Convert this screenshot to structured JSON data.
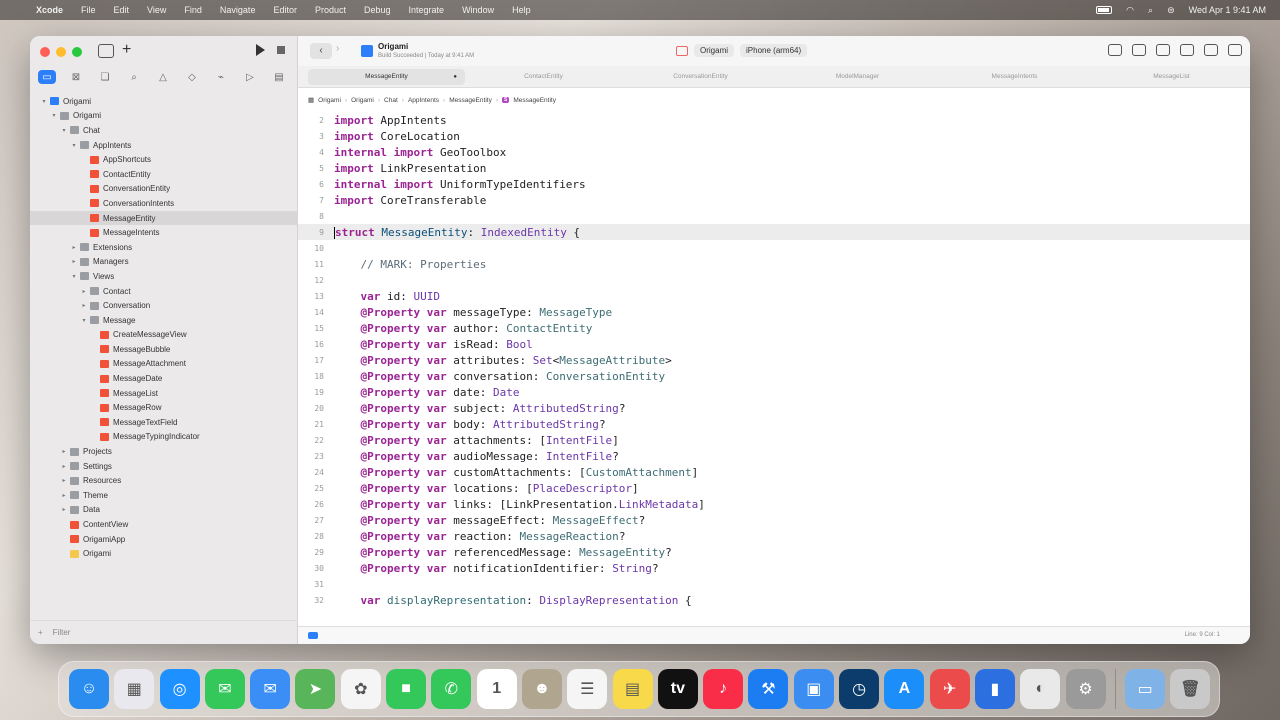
{
  "menubar": {
    "app_name": "Xcode",
    "items": [
      "File",
      "Edit",
      "View",
      "Find",
      "Navigate",
      "Editor",
      "Product",
      "Debug",
      "Integrate",
      "Window",
      "Help"
    ],
    "clock": "Wed Apr 1  9:41 AM"
  },
  "toolbar": {
    "project_title": "Origami",
    "build_status": "Build Succeeded | Today at 9:41 AM",
    "scheme": "Origami",
    "destination": "iPhone (arm64)"
  },
  "tabs": [
    {
      "label": "MessageEntity",
      "active": true
    },
    {
      "label": "ContactEntity",
      "active": false
    },
    {
      "label": "ConversationEntity",
      "active": false
    },
    {
      "label": "ModelManager",
      "active": false
    },
    {
      "label": "MessageIntents",
      "active": false
    },
    {
      "label": "MessageList",
      "active": false
    }
  ],
  "breadcrumb": [
    "Origami",
    "Origami",
    "Chat",
    "AppIntents",
    "MessageEntity",
    "MessageEntity"
  ],
  "sidebar": {
    "tree": [
      {
        "label": "Origami",
        "kind": "proj",
        "depth": 0,
        "open": true
      },
      {
        "label": "Origami",
        "kind": "folder",
        "depth": 1,
        "open": true
      },
      {
        "label": "Chat",
        "kind": "folder",
        "depth": 2,
        "open": true
      },
      {
        "label": "AppIntents",
        "kind": "folder",
        "depth": 3,
        "open": true
      },
      {
        "label": "AppShortcuts",
        "kind": "swift",
        "depth": 4
      },
      {
        "label": "ContactEntity",
        "kind": "swift",
        "depth": 4
      },
      {
        "label": "ConversationEntity",
        "kind": "swift",
        "depth": 4
      },
      {
        "label": "ConversationIntents",
        "kind": "swift",
        "depth": 4
      },
      {
        "label": "MessageEntity",
        "kind": "swift",
        "depth": 4,
        "selected": true
      },
      {
        "label": "MessageIntents",
        "kind": "swift",
        "depth": 4
      },
      {
        "label": "Extensions",
        "kind": "folder",
        "depth": 3,
        "open": false
      },
      {
        "label": "Managers",
        "kind": "folder",
        "depth": 3,
        "open": false
      },
      {
        "label": "Views",
        "kind": "folder",
        "depth": 3,
        "open": true
      },
      {
        "label": "Contact",
        "kind": "folder",
        "depth": 4,
        "open": false
      },
      {
        "label": "Conversation",
        "kind": "folder",
        "depth": 4,
        "open": false
      },
      {
        "label": "Message",
        "kind": "folder",
        "depth": 4,
        "open": true
      },
      {
        "label": "CreateMessageView",
        "kind": "swift",
        "depth": 5
      },
      {
        "label": "MessageBubble",
        "kind": "swift",
        "depth": 5
      },
      {
        "label": "MessageAttachment",
        "kind": "swift",
        "depth": 5
      },
      {
        "label": "MessageDate",
        "kind": "swift",
        "depth": 5
      },
      {
        "label": "MessageList",
        "kind": "swift",
        "depth": 5
      },
      {
        "label": "MessageRow",
        "kind": "swift",
        "depth": 5
      },
      {
        "label": "MessageTextField",
        "kind": "swift",
        "depth": 5
      },
      {
        "label": "MessageTypingIndicator",
        "kind": "swift",
        "depth": 5
      },
      {
        "label": "Projects",
        "kind": "folder",
        "depth": 2,
        "open": false
      },
      {
        "label": "Settings",
        "kind": "folder",
        "depth": 2,
        "open": false
      },
      {
        "label": "Resources",
        "kind": "folder",
        "depth": 2,
        "open": false
      },
      {
        "label": "Theme",
        "kind": "folder",
        "depth": 2,
        "open": false
      },
      {
        "label": "Data",
        "kind": "folder",
        "depth": 2,
        "open": false
      },
      {
        "label": "ContentView",
        "kind": "swift",
        "depth": 2
      },
      {
        "label": "OrigamiApp",
        "kind": "swift",
        "depth": 2
      },
      {
        "label": "Origami",
        "kind": "asset",
        "depth": 2
      }
    ],
    "filter_placeholder": "Filter"
  },
  "editor": {
    "lines": [
      {
        "n": "2",
        "html": "<span class=\"kw\">import</span> AppIntents"
      },
      {
        "n": "3",
        "html": "<span class=\"kw\">import</span> CoreLocation"
      },
      {
        "n": "4",
        "html": "<span class=\"kw\">internal</span> <span class=\"kw\">import</span> GeoToolbox"
      },
      {
        "n": "5",
        "html": "<span class=\"kw\">import</span> LinkPresentation"
      },
      {
        "n": "6",
        "html": "<span class=\"kw\">internal</span> <span class=\"kw\">import</span> UniformTypeIdentifiers"
      },
      {
        "n": "7",
        "html": "<span class=\"kw\">import</span> CoreTransferable"
      },
      {
        "n": "8",
        "html": ""
      },
      {
        "n": "9",
        "html": "<span class=\"caret\"></span><span class=\"kw\">struct</span> <span class=\"tyd\">MessageEntity</span>: <span class=\"pr\">IndexedEntity</span> {",
        "current": true
      },
      {
        "n": "10",
        "html": ""
      },
      {
        "n": "11",
        "html": "    <span class=\"cm\">// MARK: Properties</span>"
      },
      {
        "n": "12",
        "html": ""
      },
      {
        "n": "13",
        "html": "    <span class=\"kw\">var</span> id: <span class=\"pr\">UUID</span>"
      },
      {
        "n": "14",
        "html": "    <span class=\"kw\">@Property</span> <span class=\"kw\">var</span> messageType: <span class=\"ty\">MessageType</span>"
      },
      {
        "n": "15",
        "html": "    <span class=\"kw\">@Property</span> <span class=\"kw\">var</span> author: <span class=\"ty\">ContactEntity</span>"
      },
      {
        "n": "16",
        "html": "    <span class=\"kw\">@Property</span> <span class=\"kw\">var</span> isRead: <span class=\"pr\">Bool</span>"
      },
      {
        "n": "17",
        "html": "    <span class=\"kw\">@Property</span> <span class=\"kw\">var</span> attributes: <span class=\"pr\">Set</span>&lt;<span class=\"ty\">MessageAttribute</span>&gt;"
      },
      {
        "n": "18",
        "html": "    <span class=\"kw\">@Property</span> <span class=\"kw\">var</span> conversation: <span class=\"ty\">ConversationEntity</span>"
      },
      {
        "n": "19",
        "html": "    <span class=\"kw\">@Property</span> <span class=\"kw\">var</span> date: <span class=\"pr\">Date</span>"
      },
      {
        "n": "20",
        "html": "    <span class=\"kw\">@Property</span> <span class=\"kw\">var</span> subject: <span class=\"pr\">AttributedString</span>?"
      },
      {
        "n": "21",
        "html": "    <span class=\"kw\">@Property</span> <span class=\"kw\">var</span> body: <span class=\"pr\">AttributedString</span>?"
      },
      {
        "n": "22",
        "html": "    <span class=\"kw\">@Property</span> <span class=\"kw\">var</span> attachments: [<span class=\"pr\">IntentFile</span>]"
      },
      {
        "n": "23",
        "html": "    <span class=\"kw\">@Property</span> <span class=\"kw\">var</span> audioMessage: <span class=\"pr\">IntentFile</span>?"
      },
      {
        "n": "24",
        "html": "    <span class=\"kw\">@Property</span> <span class=\"kw\">var</span> customAttachments: [<span class=\"ty\">CustomAttachment</span>]"
      },
      {
        "n": "25",
        "html": "    <span class=\"kw\">@Property</span> <span class=\"kw\">var</span> locations: [<span class=\"pr\">PlaceDescriptor</span>]"
      },
      {
        "n": "26",
        "html": "    <span class=\"kw\">@Property</span> <span class=\"kw\">var</span> links: [LinkPresentation.<span class=\"pr\">LinkMetadata</span>]"
      },
      {
        "n": "27",
        "html": "    <span class=\"kw\">@Property</span> <span class=\"kw\">var</span> messageEffect: <span class=\"ty\">MessageEffect</span>?"
      },
      {
        "n": "28",
        "html": "    <span class=\"kw\">@Property</span> <span class=\"kw\">var</span> reaction: <span class=\"ty\">MessageReaction</span>?"
      },
      {
        "n": "29",
        "html": "    <span class=\"kw\">@Property</span> <span class=\"kw\">var</span> referencedMessage: <span class=\"ty\">MessageEntity</span>?"
      },
      {
        "n": "30",
        "html": "    <span class=\"kw\">@Property</span> <span class=\"kw\">var</span> notificationIdentifier: <span class=\"pr\">String</span>?"
      },
      {
        "n": "31",
        "html": ""
      },
      {
        "n": "32",
        "html": "    <span class=\"kw\">var</span> <span class=\"fn\">displayRepresentation</span>: <span class=\"pr\">DisplayRepresentation</span> {"
      }
    ]
  },
  "statusbar": {
    "position": "Line: 9  Col: 1"
  },
  "dock": [
    {
      "name": "finder",
      "color": "#2b8cf0",
      "glyph": "☺"
    },
    {
      "name": "launchpad",
      "color": "#e8e8ee",
      "glyph": "▦"
    },
    {
      "name": "safari",
      "color": "#1e90ff",
      "glyph": "◎"
    },
    {
      "name": "messages",
      "color": "#34c759",
      "glyph": "✉"
    },
    {
      "name": "mail",
      "color": "#3a8ef6",
      "glyph": "✉"
    },
    {
      "name": "maps",
      "color": "#59b55a",
      "glyph": "➤"
    },
    {
      "name": "photos",
      "color": "#f5f5f5",
      "glyph": "✿"
    },
    {
      "name": "facetime",
      "color": "#34c759",
      "glyph": "■"
    },
    {
      "name": "phone",
      "color": "#34c759",
      "glyph": "✆"
    },
    {
      "name": "calendar",
      "color": "#ffffff",
      "glyph": "1"
    },
    {
      "name": "contacts",
      "color": "#b0a58f",
      "glyph": "☻"
    },
    {
      "name": "reminders",
      "color": "#f5f5f5",
      "glyph": "☰"
    },
    {
      "name": "notes",
      "color": "#f8d94a",
      "glyph": "▤"
    },
    {
      "name": "tv",
      "color": "#111111",
      "glyph": "tv"
    },
    {
      "name": "music",
      "color": "#fa2d48",
      "glyph": "♪"
    },
    {
      "name": "xcode",
      "color": "#1c7cf2",
      "glyph": "⚒"
    },
    {
      "name": "simulator",
      "color": "#3b8df1",
      "glyph": "▣"
    },
    {
      "name": "instruments",
      "color": "#0b3c6b",
      "glyph": "◷"
    },
    {
      "name": "app-store",
      "color": "#1c8ef9",
      "glyph": "A"
    },
    {
      "name": "testflight",
      "color": "#ec4b4b",
      "glyph": "✈"
    },
    {
      "name": "config",
      "color": "#2b6fe0",
      "glyph": "▮"
    },
    {
      "name": "compass",
      "color": "#e9e9e9",
      "glyph": "◐"
    },
    {
      "name": "system-settings",
      "color": "#9a9a9a",
      "glyph": "⚙"
    },
    {
      "name": "downloads",
      "color": "#7fb2e6",
      "glyph": "▭"
    },
    {
      "name": "trash",
      "color": "#c9c9c9",
      "glyph": "🗑"
    }
  ]
}
